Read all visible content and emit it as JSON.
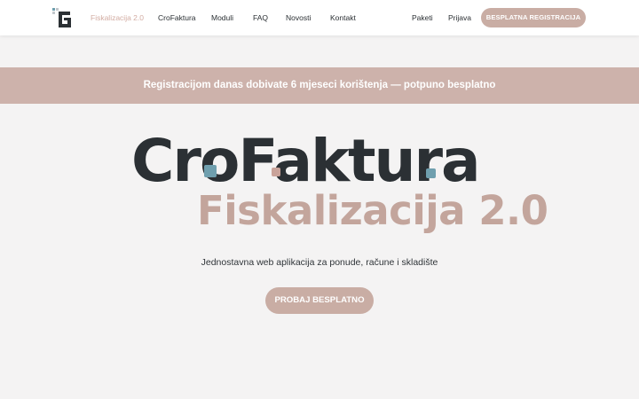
{
  "header": {
    "logo_icon": "crofaktura-logo-icon",
    "nav": [
      {
        "label": "Fiskalizacija 2.0",
        "active": true
      },
      {
        "label": "CroFaktura"
      },
      {
        "label": "Moduli"
      },
      {
        "label": "FAQ"
      },
      {
        "label": "Novosti"
      },
      {
        "label": "Kontakt"
      }
    ],
    "right_links": [
      {
        "label": "Paketi"
      },
      {
        "label": "Prijava"
      }
    ],
    "register_button": "BESPLATNA REGISTRACIJA"
  },
  "promo": {
    "text": "Registracijom danas dobivate 6 mjeseci korištenja — potpuno besplatno"
  },
  "hero": {
    "title": "CroFaktura",
    "subtitle": "Fiskalizacija 2.0",
    "tagline": "Jednostavna web aplikacija za ponude, račune i skladište",
    "cta_button": "PROBAJ BESPLATNO"
  },
  "colors": {
    "accent": "#c9ada4",
    "active_nav": "#d2aca2",
    "dark_text": "#2b3034",
    "banner": "#cdb2ab",
    "dot_blue": "#6f9fae",
    "dot_pink": "#c9a39a",
    "background": "#f4f3f3"
  }
}
